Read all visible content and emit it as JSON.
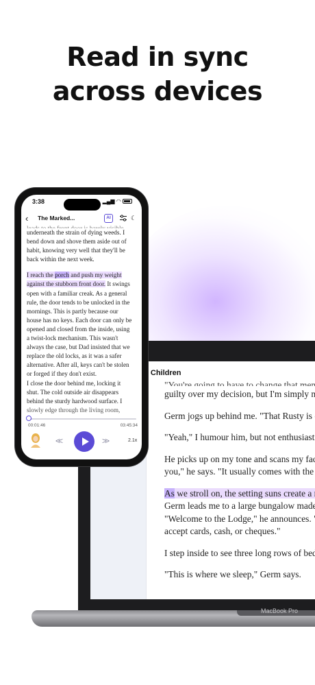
{
  "headline": {
    "line1": "Read in sync",
    "line2": "across devices"
  },
  "colors": {
    "accent": "#5b4bd6",
    "highlight_word": "#c7b2fb",
    "highlight_line": "#eadbfd",
    "glow": "#c8a8ff"
  },
  "phone": {
    "status_time": "3:38",
    "title": "The Marked...",
    "ai_label": "AI",
    "icons": [
      "back-chevron-icon",
      "ai-icon",
      "settings-sliders-icon",
      "moon-icon"
    ],
    "text_lines_top": [
      "leads to the front door is barely visible",
      "underneath the strain of dying weeds. I",
      "bend down and shove them aside out of",
      "habit, knowing very well that they'll be",
      "back within the next week."
    ],
    "hl_line1_a": "I reach the ",
    "hl_line1_word": "porch",
    "hl_line1_b": " and push my weight",
    "hl_line2": "against the stubborn front door.",
    "hl_line2_rest": " It swings",
    "text_lines_rest": [
      "open with a familiar creak. As a general",
      "rule, the door tends to be unlocked in the",
      "mornings. This is partly because our",
      "house has no keys. Each door can only be",
      "opened and closed from the inside, using",
      "a twist-lock mechanism. This wasn't",
      "always the case, but Dad insisted that we",
      "replace the old locks, as it was a safer",
      "alternative. After all, keys can't be stolen",
      "or forged if they don't exist.",
      "I close the door behind me, locking it",
      "shut. The cold outside air disappears",
      "behind the sturdy hardwood surface. I",
      "slowly edge through the living room,"
    ],
    "player": {
      "elapsed": "00:01:46",
      "remaining": "03:45:34",
      "progress": 0.02,
      "speed": "2.1x",
      "skip_back": "<<",
      "skip_forward": ">>"
    }
  },
  "laptop": {
    "chapter_title": "ed Children",
    "brand": "MacBook Pro",
    "paragraphs": {
      "p0_cut": "\"You're going to have to change that mentality",
      "p0": "guilty over my decision, but I'm simply not",
      "p1": "Germ jogs up behind me. \"That Rusty is quite",
      "p2": "\"Yeah,\" I humour him, but not enthusiastically.",
      "p3a": "He picks up on my tone and scans my face.",
      "p3b": "you,\" he says. \"It usually comes with the nam",
      "p4_word": "As",
      "p4_rest": " we stroll on, the setting suns create a r",
      "p4b": "Germ leads me to a large bungalow made",
      "p4c": "\"Welcome to the Lodge,\" he announces. \"",
      "p4d": "accept cards, cash, or cheques.\"",
      "p5": "I step inside to see three long rows of bed",
      "p6": "\"This is where we sleep,\" Germ says."
    }
  }
}
